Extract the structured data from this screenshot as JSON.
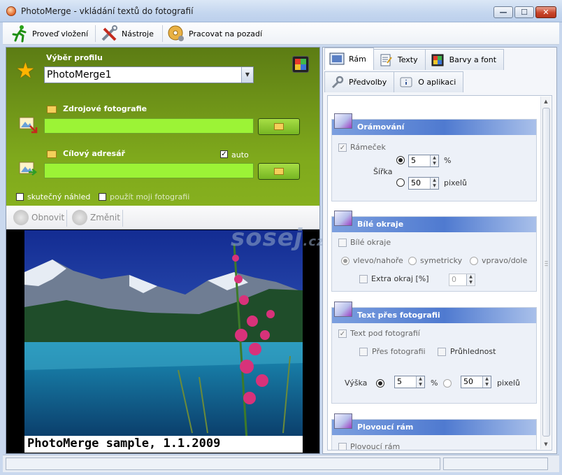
{
  "window": {
    "title": "PhotoMerge - vkládání textů do fotografií",
    "min_glyph": "—",
    "max_glyph": "☐",
    "close_glyph": "✕"
  },
  "toolbar": {
    "items": [
      {
        "label": "Proveď vložení",
        "icon": "running-man-icon"
      },
      {
        "label": "Nástroje",
        "icon": "tools-icon"
      },
      {
        "label": "Pracovat na pozadí",
        "icon": "cd-gear-icon"
      }
    ]
  },
  "left_panel": {
    "profile_label": "Výběr profilu",
    "profile_value": "PhotoMerge1",
    "source_label": "Zdrojové fotografie",
    "source_value": "",
    "target_label": "Cílový adresář",
    "target_value": "",
    "auto_label": "auto",
    "auto_checked": true,
    "real_preview_label": "skutečný náhled",
    "use_my_photo_label": "použít moji fotografii",
    "refresh_label": "Obnovit",
    "change_label": "Změnit",
    "preview_caption": "PhotoMerge sample, 1.1.2009",
    "watermark_text": "sosej",
    "watermark_suffix": ".cz"
  },
  "right_panel": {
    "tabs": [
      {
        "label": "Rám",
        "icon": "frame-icon",
        "active": true
      },
      {
        "label": "Texty",
        "icon": "text-doc-icon",
        "active": false
      },
      {
        "label": "Barvy a font",
        "icon": "palette-icon",
        "active": false
      },
      {
        "label": "Předvolby",
        "icon": "wrench-icon",
        "active": false
      },
      {
        "label": "O aplikaci",
        "icon": "info-icon",
        "active": false
      }
    ],
    "groups": {
      "ramovani": {
        "title": "Orámování",
        "frame_label": "Rámeček",
        "width_label": "Šířka",
        "percent_value": "5",
        "percent_unit": "%",
        "pixel_value": "50",
        "pixel_unit": "pixelů"
      },
      "bile_okraje": {
        "title": "Bílé okraje",
        "enable_label": "Bílé okraje",
        "opt_top": "vlevo/nahoře",
        "opt_sym": "symetricky",
        "opt_bottom": "vpravo/dole",
        "extra_label": "Extra okraj [%]",
        "extra_value": "0"
      },
      "text_pres": {
        "title": "Text přes fotografii",
        "below_label": "Text pod fotografií",
        "over_label": "Přes fotografii",
        "transparency_label": "Průhlednost",
        "height_label": "Výška",
        "percent_value": "5",
        "percent_unit": "%",
        "pixel_value": "50",
        "pixel_unit": "pixelů"
      },
      "plovouci": {
        "title": "Plovoucí rám",
        "enable_label": "Plovoucí rám"
      }
    }
  },
  "statusbar": {
    "left": "",
    "right": ""
  }
}
